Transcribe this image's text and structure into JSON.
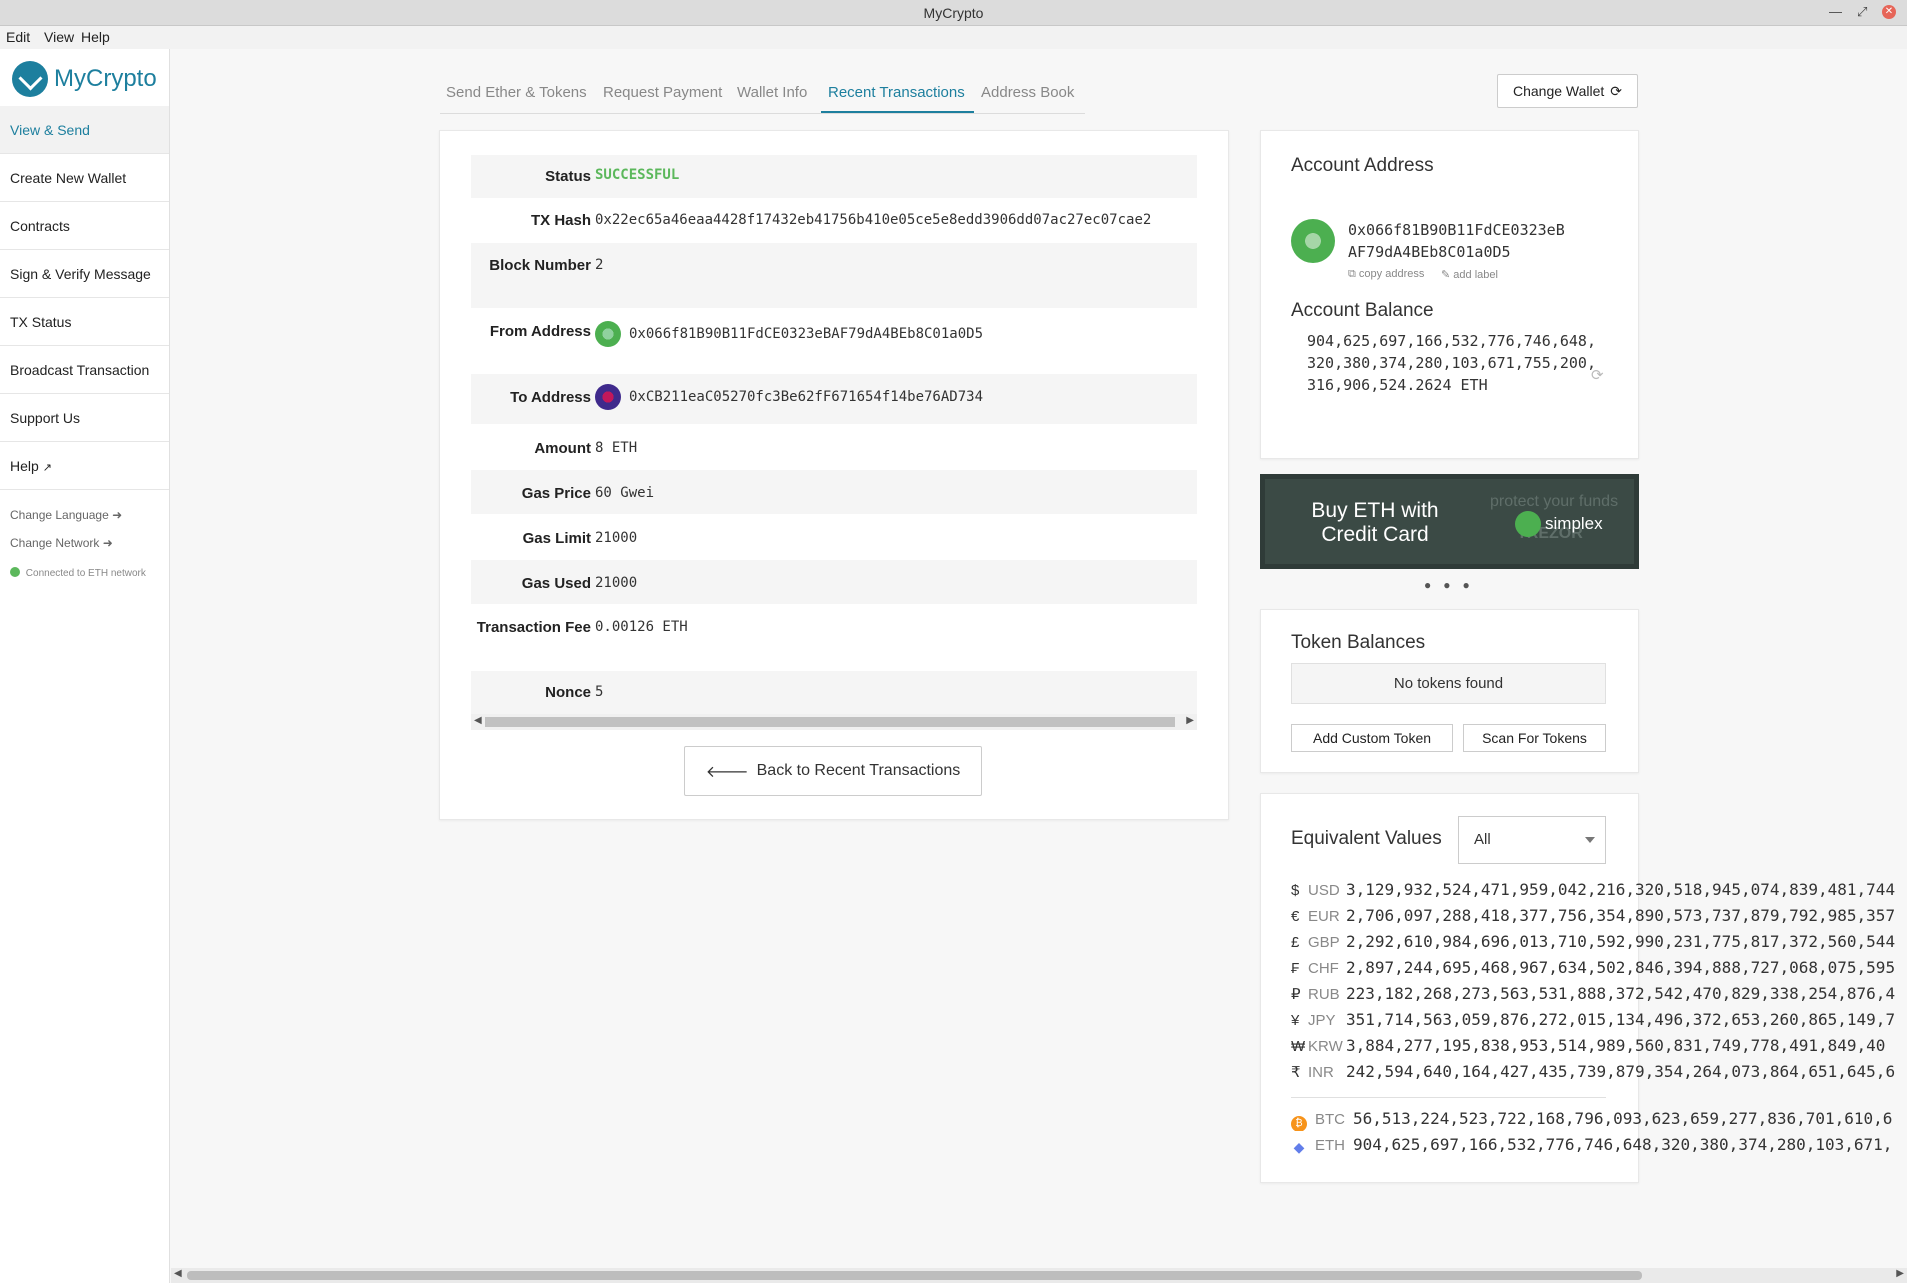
{
  "window": {
    "title": "MyCrypto"
  },
  "menu": [
    "Edit",
    "View",
    "Help"
  ],
  "sidebar": {
    "brand": "MyCrypto",
    "items": [
      {
        "label": "View & Send",
        "active": true
      },
      {
        "label": "Create New Wallet"
      },
      {
        "label": "Contracts"
      },
      {
        "label": "Sign & Verify Message"
      },
      {
        "label": "TX Status"
      },
      {
        "label": "Broadcast Transaction"
      },
      {
        "label": "Support Us"
      },
      {
        "label": "Help"
      }
    ],
    "change_language": "Change Language",
    "change_network": "Change Network",
    "network_status": "Connected to ETH network"
  },
  "tabs": [
    {
      "label": "Send Ether & Tokens"
    },
    {
      "label": "Request Payment"
    },
    {
      "label": "Wallet Info"
    },
    {
      "label": "Recent Transactions",
      "active": true
    },
    {
      "label": "Address Book"
    }
  ],
  "change_wallet_label": "Change Wallet",
  "tx": {
    "status_label": "Status",
    "status_value": "SUCCESSFUL",
    "hash_label": "TX Hash",
    "hash_value": "0x22ec65a46eaa4428f17432eb41756b410e05ce5e8edd3906dd07ac27ec07cae2",
    "block_label": "Block Number",
    "block_value": "2",
    "from_label": "From Address",
    "from_value": "0x066f81B90B11FdCE0323eBAF79dA4BEb8C01a0D5",
    "to_label": "To Address",
    "to_value": "0xCB211eaC05270fc3Be62fF671654f14be76AD734",
    "amount_label": "Amount",
    "amount_value": "8 ETH",
    "gas_price_label": "Gas Price",
    "gas_price_value": "60 Gwei",
    "gas_limit_label": "Gas Limit",
    "gas_limit_value": "21000",
    "gas_used_label": "Gas Used",
    "gas_used_value": "21000",
    "fee_label": "Transaction Fee",
    "fee_value": "0.00126 ETH",
    "nonce_label": "Nonce",
    "nonce_value": "5"
  },
  "back_button": "Back to Recent Transactions",
  "account": {
    "title": "Account Address",
    "address_line1": "0x066f81B90B11FdCE0323eB",
    "address_line2": "AF79dA4BEb8C01a0D5",
    "copy_address": "copy address",
    "add_label": "add label",
    "balance_title": "Account Balance",
    "balance": "904,625,697,166,532,776,746,648,320,380,374,280,103,671,755,200,316,906,524.2624 ETH"
  },
  "banner": {
    "text": "Buy ETH with Credit Card",
    "brand": "simplex",
    "ghost_text": "protect your funds",
    "ghost_brand": "TREZOR"
  },
  "tokens": {
    "title": "Token Balances",
    "empty": "No tokens found",
    "add_custom": "Add Custom Token",
    "scan": "Scan For Tokens"
  },
  "equiv": {
    "title": "Equivalent Values",
    "selected": "All",
    "rows": [
      {
        "sym": "$",
        "code": "USD",
        "value": "3,129,932,524,471,959,042,216,320,518,945,074,839,481,744"
      },
      {
        "sym": "€",
        "code": "EUR",
        "value": "2,706,097,288,418,377,756,354,890,573,737,879,792,985,357"
      },
      {
        "sym": "£",
        "code": "GBP",
        "value": "2,292,610,984,696,013,710,592,990,231,775,817,372,560,544"
      },
      {
        "sym": "₣",
        "code": "CHF",
        "value": "2,897,244,695,468,967,634,502,846,394,888,727,068,075,595"
      },
      {
        "sym": "₽",
        "code": "RUB",
        "value": "223,182,268,273,563,531,888,372,542,470,829,338,254,876,4"
      },
      {
        "sym": "¥",
        "code": "JPY",
        "value": "351,714,563,059,876,272,015,134,496,372,653,260,865,149,7"
      },
      {
        "sym": "₩",
        "code": "KRW",
        "value": "3,884,277,195,838,953,514,989,560,831,749,778,491,849,40"
      },
      {
        "sym": "₹",
        "code": "INR",
        "value": "242,594,640,164,427,435,739,879,354,264,073,864,651,645,6"
      }
    ],
    "crypto": [
      {
        "code": "BTC",
        "value": "56,513,224,523,722,168,796,093,623,659,277,836,701,610,6",
        "color": "#f7931a"
      },
      {
        "code": "ETH",
        "value": "904,625,697,166,532,776,746,648,320,380,374,280,103,671,",
        "color": "#627eea"
      }
    ]
  }
}
